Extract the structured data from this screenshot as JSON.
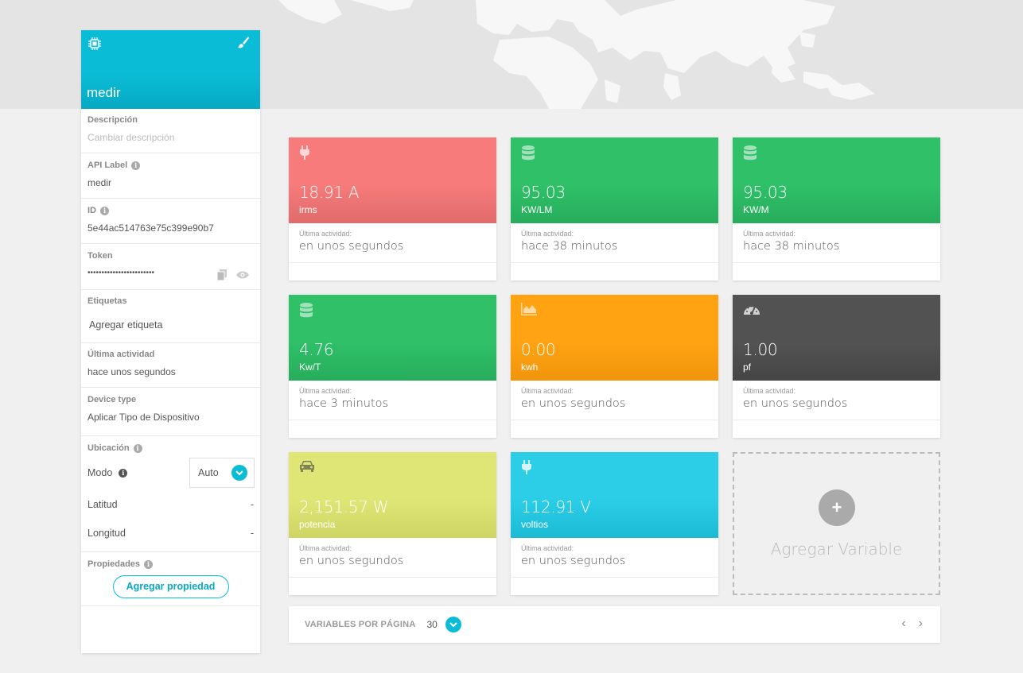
{
  "device": {
    "name": "medir",
    "colors": {
      "accent": "#0bbcd6"
    }
  },
  "sidebar": {
    "description": {
      "label": "Descripción",
      "placeholder": "Cambiar descripción"
    },
    "api_label": {
      "label": "API Label",
      "value": "medir"
    },
    "id": {
      "label": "ID",
      "value": "5e44ac514763e75c399e90b7"
    },
    "token": {
      "label": "Token",
      "value": "••••••••••••••••••••••••"
    },
    "tags": {
      "label": "Etiquetas",
      "add_label": "Agregar etiqueta"
    },
    "last_activity": {
      "label": "Última actividad",
      "value": "hace unos segundos"
    },
    "device_type": {
      "label": "Device type",
      "value": "Aplicar Tipo de Dispositivo"
    },
    "location": {
      "label": "Ubicación",
      "mode_label": "Modo",
      "mode_value": "Auto",
      "latitude_label": "Latitud",
      "latitude_value": "-",
      "longitude_label": "Longitud",
      "longitude_value": "-"
    },
    "properties": {
      "label": "Propiedades",
      "add_button": "Agregar propiedad"
    }
  },
  "variables": [
    {
      "value": "18.91 A",
      "unit": "irms",
      "activity_label": "Última actividad:",
      "activity": "en unos segundos",
      "color": "#f77b7b",
      "icon": "plug-icon"
    },
    {
      "value": "95.03",
      "unit": "KW/LM",
      "activity_label": "Última actividad:",
      "activity": "hace 38 minutos",
      "color": "#2fc068",
      "icon": "database-icon"
    },
    {
      "value": "95.03",
      "unit": "KW/M",
      "activity_label": "Última actividad:",
      "activity": "hace 38 minutos",
      "color": "#2fc068",
      "icon": "database-icon"
    },
    {
      "value": "4.76",
      "unit": "Kw/T",
      "activity_label": "Última actividad:",
      "activity": "hace 3 minutos",
      "color": "#2fc068",
      "icon": "database-icon"
    },
    {
      "value": "0.00",
      "unit": "kwh",
      "activity_label": "Última actividad:",
      "activity": "en unos segundos",
      "color": "#ffa312",
      "icon": "area-chart-icon"
    },
    {
      "value": "1.00",
      "unit": "pf",
      "activity_label": "Última actividad:",
      "activity": "en unos segundos",
      "color": "#525252",
      "icon": "gauge-icon"
    },
    {
      "value": "2,151.57 W",
      "unit": "potencia",
      "activity_label": "Última actividad:",
      "activity": "en unos segundos",
      "color": "#dfe675",
      "icon": "car-icon"
    },
    {
      "value": "112.91 V",
      "unit": "voltios",
      "activity_label": "Última actividad:",
      "activity": "en unos segundos",
      "color": "#2ccde6",
      "icon": "plug-icon"
    }
  ],
  "add_variable": {
    "label": "Agregar Variable"
  },
  "pager": {
    "per_page_label": "VARIABLES POR PÁGINA",
    "per_page_value": "30",
    "prev": "‹",
    "next": "›"
  }
}
